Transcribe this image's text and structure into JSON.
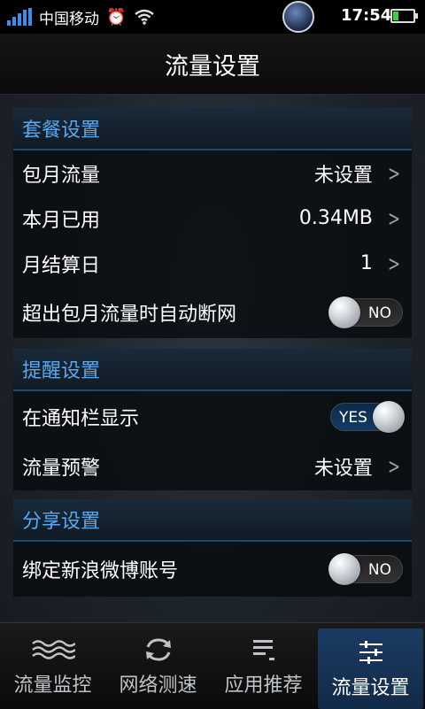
{
  "status_bar": {
    "carrier": "中国移动",
    "time": "17:54",
    "battery_level": 0.25,
    "icons": [
      "signal-icon",
      "alarm-icon",
      "wifi-icon",
      "app-logo-icon",
      "battery-icon"
    ]
  },
  "header": {
    "title": "流量设置"
  },
  "groups": [
    {
      "title": "套餐设置",
      "rows": [
        {
          "label": "包月流量",
          "value": "未设置",
          "type": "link"
        },
        {
          "label": "本月已用",
          "value": "0.34MB",
          "type": "link"
        },
        {
          "label": "月结算日",
          "value": "1",
          "type": "link"
        },
        {
          "label": "超出包月流量时自动断网",
          "toggle": "NO",
          "type": "toggle"
        }
      ]
    },
    {
      "title": "提醒设置",
      "rows": [
        {
          "label": "在通知栏显示",
          "toggle": "YES",
          "type": "toggle"
        },
        {
          "label": "流量预警",
          "value": "未设置",
          "type": "link"
        }
      ]
    },
    {
      "title": "分享设置",
      "rows": [
        {
          "label": "绑定新浪微博账号",
          "toggle": "NO",
          "type": "toggle"
        }
      ]
    }
  ],
  "bottom_nav": {
    "tabs": [
      {
        "label": "流量监控",
        "icon": "waves-icon"
      },
      {
        "label": "网络测速",
        "icon": "refresh-icon"
      },
      {
        "label": "应用推荐",
        "icon": "list-icon"
      },
      {
        "label": "流量设置",
        "icon": "sliders-icon",
        "active": true
      }
    ]
  },
  "colors": {
    "accent": "#5aa8f0",
    "active_tab": "#1b3b63",
    "signal": "#3a8ee8",
    "battery": "#3cd13c"
  }
}
